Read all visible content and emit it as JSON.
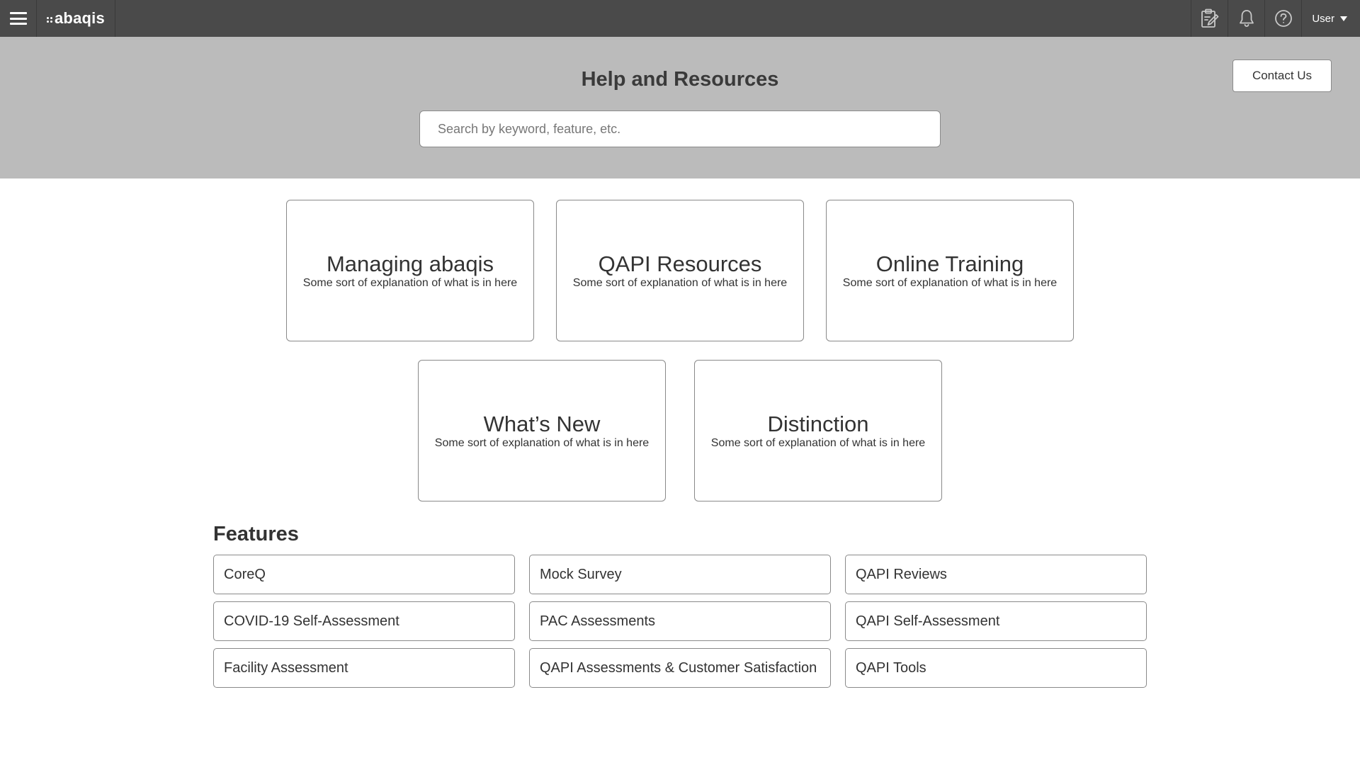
{
  "topbar": {
    "brand": "abaqis",
    "user_label": "User",
    "icons": [
      "menu-icon",
      "clipboard-edit-icon",
      "bell-icon",
      "help-circle-icon",
      "caret-down-icon"
    ]
  },
  "hero": {
    "title": "Help and Resources",
    "contact_label": "Contact Us",
    "search_placeholder": "Search by keyword, feature, etc.",
    "search_value": ""
  },
  "cards": [
    {
      "title": "Managing abaqis",
      "desc": "Some sort of explanation of what is in here"
    },
    {
      "title": "QAPI Resources",
      "desc": "Some sort of explanation of what is in here"
    },
    {
      "title": "Online Training",
      "desc": "Some sort of explanation of what is in here"
    },
    {
      "title": "What’s New",
      "desc": "Some sort of explanation of what is in here"
    },
    {
      "title": "Distinction",
      "desc": "Some sort of explanation of what is in here"
    }
  ],
  "features": {
    "heading": "Features",
    "items": [
      "CoreQ",
      "Mock Survey",
      "QAPI Reviews",
      "COVID-19 Self-Assessment",
      "PAC Assessments",
      "QAPI Self-Assessment",
      "Facility Assessment",
      "QAPI Assessments & Customer Satisfaction",
      "QAPI Tools"
    ]
  },
  "colors": {
    "topbar": "#4a4a4a",
    "hero": "#bbbbbb",
    "border": "#8a8a8a",
    "text": "#333333"
  }
}
